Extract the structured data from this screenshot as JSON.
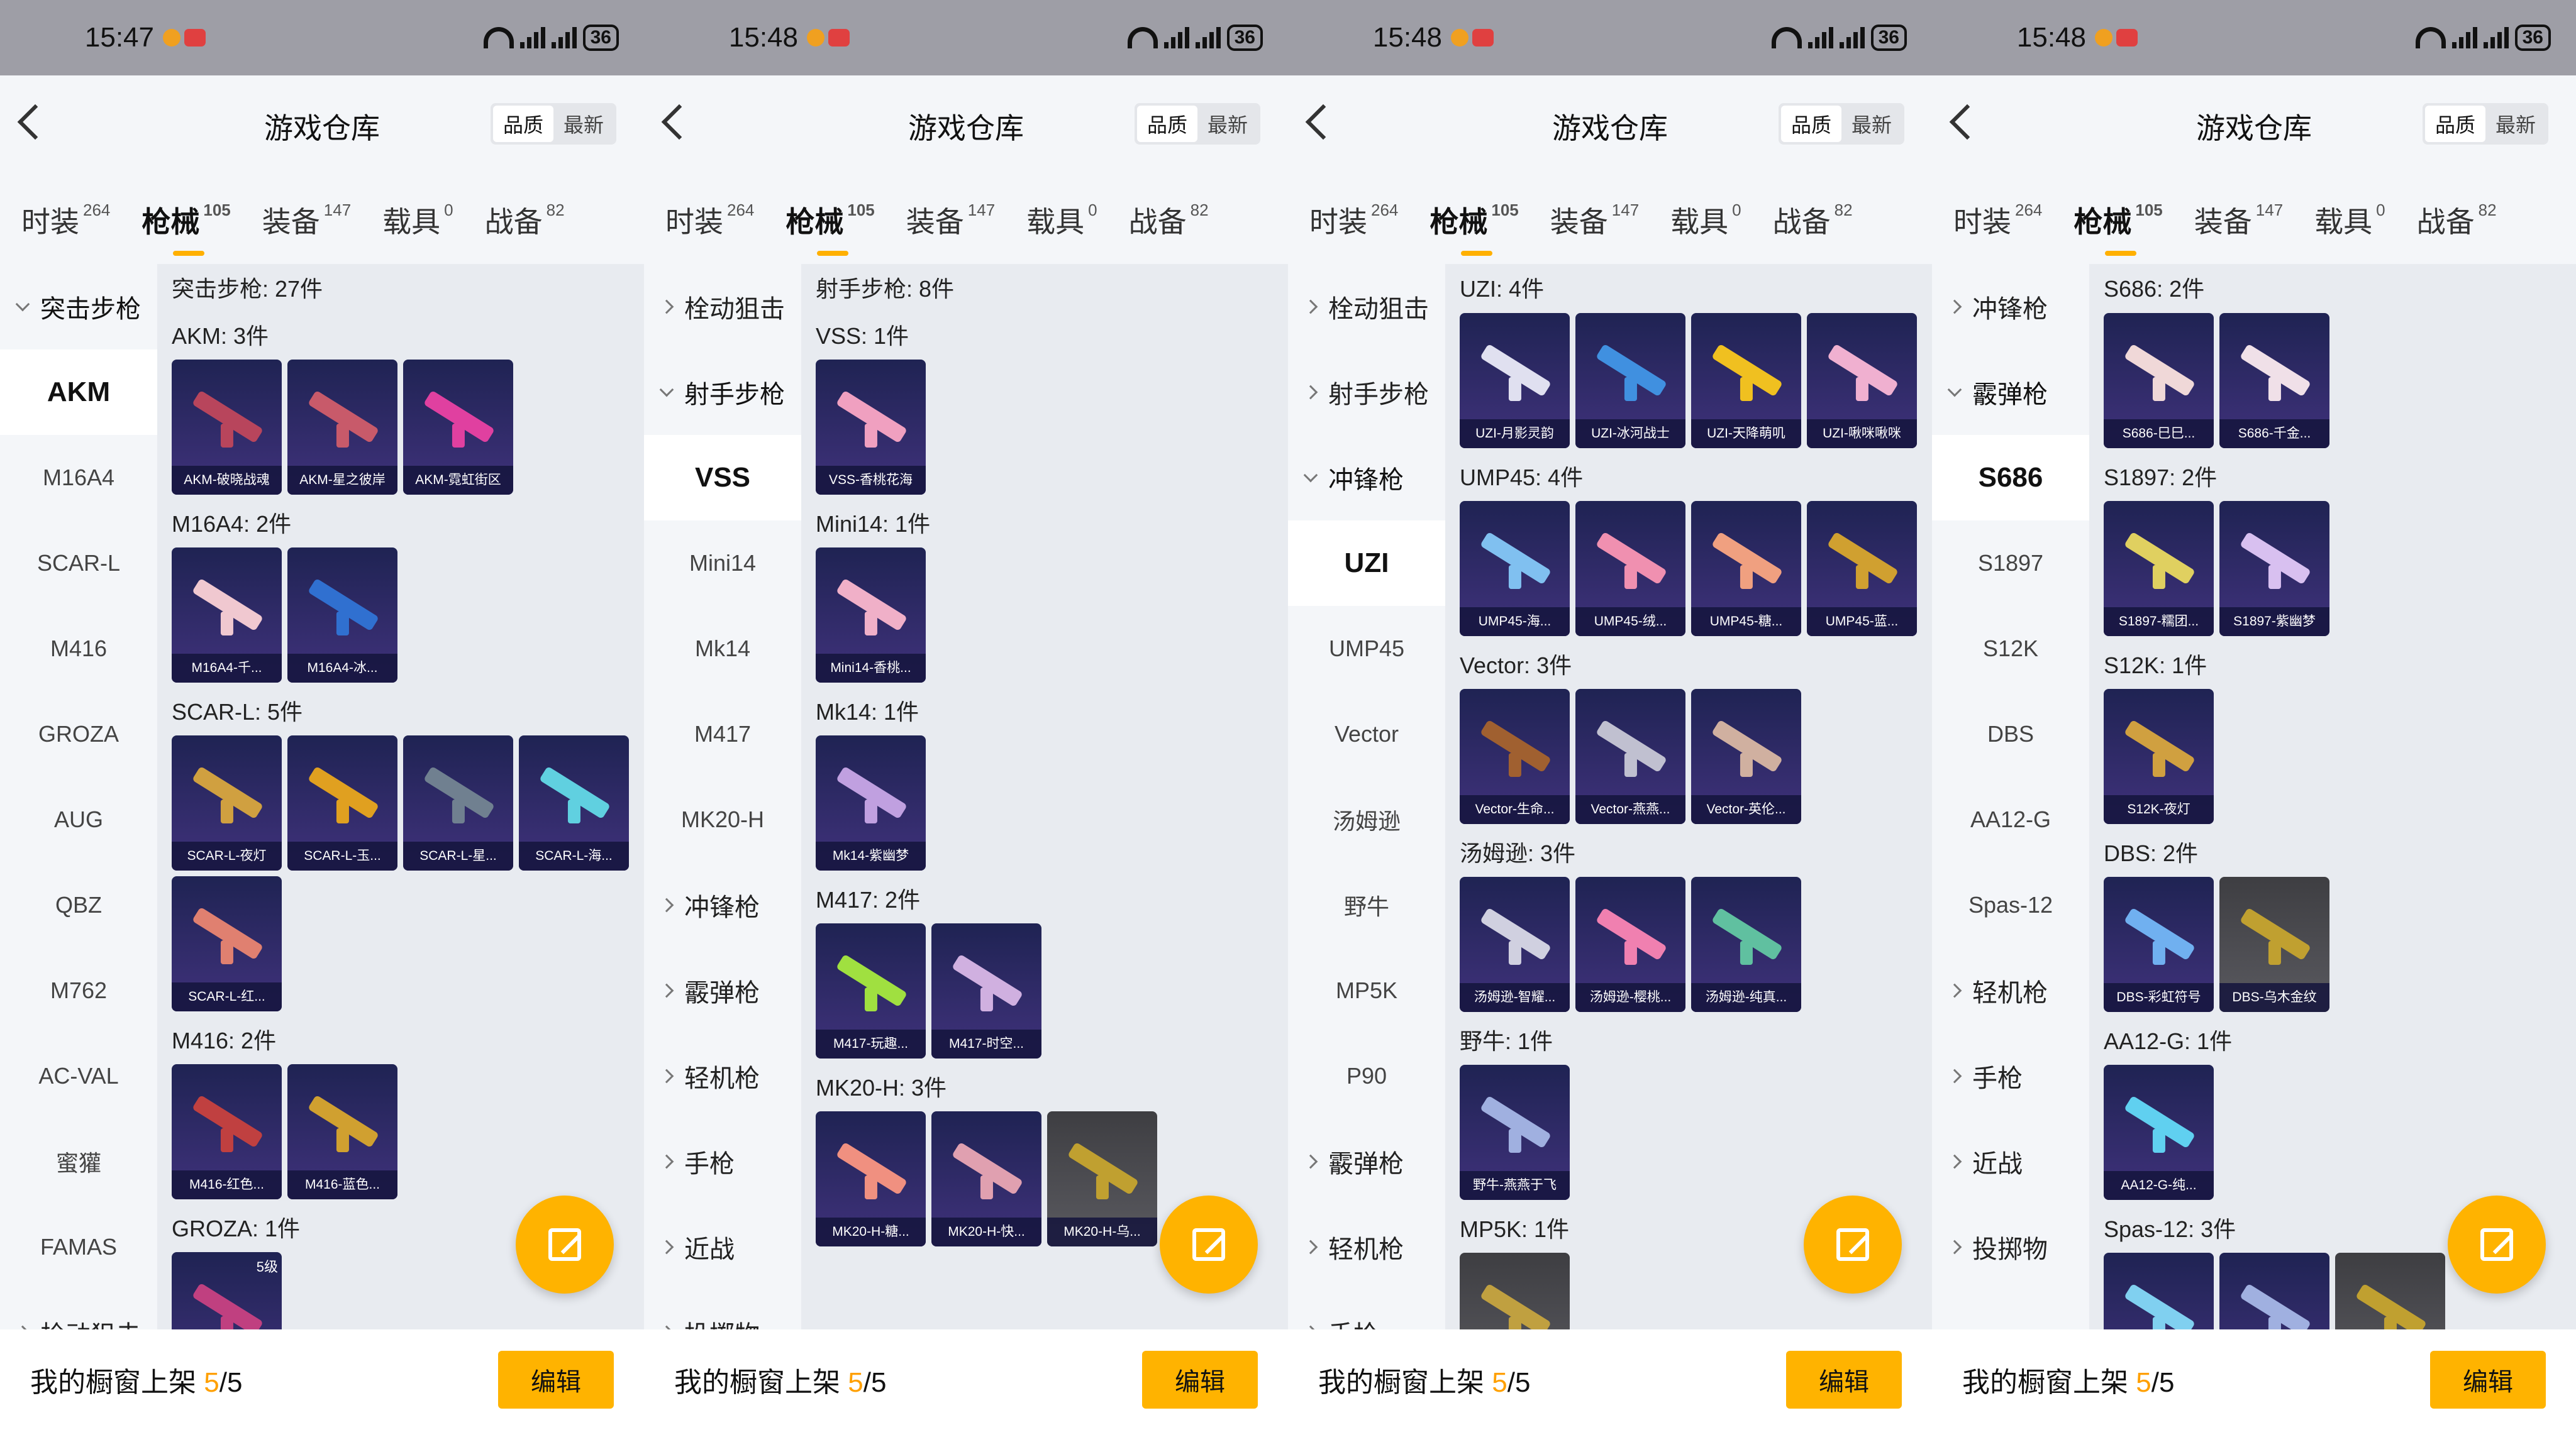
{
  "colors": {
    "accent": "#ffb300",
    "card_bg": "#2a2a66",
    "status_bar": "#9e9ea6"
  },
  "panels": [
    {
      "status": {
        "time": "15:47",
        "battery": "36"
      },
      "title": "游戏仓库",
      "sort": [
        "品质",
        "最新"
      ],
      "tabs": [
        {
          "label": "时装",
          "count": "264"
        },
        {
          "label": "枪械",
          "count": "105",
          "active": true
        },
        {
          "label": "装备",
          "count": "147"
        },
        {
          "label": "载具",
          "count": "0"
        },
        {
          "label": "战备",
          "count": "82"
        }
      ],
      "sidebar": [
        {
          "label": "突击步枪",
          "type": "group",
          "open": true
        },
        {
          "label": "AKM",
          "active": true
        },
        {
          "label": "M16A4"
        },
        {
          "label": "SCAR-L"
        },
        {
          "label": "M416"
        },
        {
          "label": "GROZA"
        },
        {
          "label": "AUG"
        },
        {
          "label": "QBZ"
        },
        {
          "label": "M762"
        },
        {
          "label": "AC-VAL"
        },
        {
          "label": "蜜獾"
        },
        {
          "label": "FAMAS"
        },
        {
          "label": "栓动狙击",
          "type": "group"
        }
      ],
      "sections": [
        {
          "title": "突击步枪: 27件",
          "items": []
        },
        {
          "title": "AKM: 3件",
          "items": [
            {
              "label": "AKM-破晓战魂",
              "gun": "#b8455c"
            },
            {
              "label": "AKM-星之彼岸",
              "gun": "#c85a6a"
            },
            {
              "label": "AKM-霓虹街区",
              "gun": "#e040a0"
            }
          ]
        },
        {
          "title": "M16A4: 2件",
          "items": [
            {
              "label": "M16A4-千...",
              "gun": "#f0c8d0"
            },
            {
              "label": "M16A4-冰...",
              "gun": "#3070d0"
            }
          ]
        },
        {
          "title": "SCAR-L: 5件",
          "items": [
            {
              "label": "SCAR-L-夜灯",
              "gun": "#d0a040"
            },
            {
              "label": "SCAR-L-玉...",
              "gun": "#e0a020"
            },
            {
              "label": "SCAR-L-星...",
              "gun": "#708090"
            },
            {
              "label": "SCAR-L-海...",
              "gun": "#60d0e0"
            },
            {
              "label": "SCAR-L-红...",
              "gun": "#e08070"
            }
          ]
        },
        {
          "title": "M416: 2件",
          "items": [
            {
              "label": "M416-红色...",
              "gun": "#c04040"
            },
            {
              "label": "M416-蓝色...",
              "gun": "#d0a030"
            }
          ]
        },
        {
          "title": "GROZA: 1件",
          "items": [
            {
              "label": "",
              "gun": "#c04080",
              "badge": "5级"
            }
          ]
        }
      ],
      "footer": {
        "text": "我的橱窗上架",
        "count": "5",
        "total": "/5",
        "edit": "编辑"
      }
    },
    {
      "status": {
        "time": "15:48",
        "battery": "36"
      },
      "title": "游戏仓库",
      "sort": [
        "品质",
        "最新"
      ],
      "tabs": [
        {
          "label": "时装",
          "count": "264"
        },
        {
          "label": "枪械",
          "count": "105",
          "active": true
        },
        {
          "label": "装备",
          "count": "147"
        },
        {
          "label": "载具",
          "count": "0"
        },
        {
          "label": "战备",
          "count": "82"
        }
      ],
      "sidebar": [
        {
          "label": "栓动狙击",
          "type": "group"
        },
        {
          "label": "射手步枪",
          "type": "group",
          "open": true
        },
        {
          "label": "VSS",
          "active": true
        },
        {
          "label": "Mini14"
        },
        {
          "label": "Mk14"
        },
        {
          "label": "M417"
        },
        {
          "label": "MK20-H"
        },
        {
          "label": "冲锋枪",
          "type": "group"
        },
        {
          "label": "霰弹枪",
          "type": "group"
        },
        {
          "label": "轻机枪",
          "type": "group"
        },
        {
          "label": "手枪",
          "type": "group"
        },
        {
          "label": "近战",
          "type": "group"
        },
        {
          "label": "投掷物",
          "type": "group"
        }
      ],
      "sections": [
        {
          "title": "射手步枪: 8件",
          "items": []
        },
        {
          "title": "VSS: 1件",
          "items": [
            {
              "label": "VSS-香桃花海",
              "gun": "#f0a0c0"
            }
          ]
        },
        {
          "title": "Mini14: 1件",
          "items": [
            {
              "label": "Mini14-香桃...",
              "gun": "#f0b0c8"
            }
          ]
        },
        {
          "title": "Mk14: 1件",
          "items": [
            {
              "label": "Mk14-紫幽梦",
              "gun": "#c0a0e0"
            }
          ]
        },
        {
          "title": "M417: 2件",
          "items": [
            {
              "label": "M417-玩趣...",
              "gun": "#a0e040"
            },
            {
              "label": "M417-时空...",
              "gun": "#d0b0e0"
            }
          ]
        },
        {
          "title": "MK20-H: 3件",
          "items": [
            {
              "label": "MK20-H-糖...",
              "gun": "#f09080"
            },
            {
              "label": "MK20-H-快...",
              "gun": "#e0a0b0"
            },
            {
              "label": "MK20-H-乌...",
              "gun": "#c0a030",
              "gray": true
            }
          ]
        }
      ],
      "footer": {
        "text": "我的橱窗上架",
        "count": "5",
        "total": "/5",
        "edit": "编辑"
      }
    },
    {
      "status": {
        "time": "15:48",
        "battery": "36"
      },
      "title": "游戏仓库",
      "sort": [
        "品质",
        "最新"
      ],
      "tabs": [
        {
          "label": "时装",
          "count": "264"
        },
        {
          "label": "枪械",
          "count": "105",
          "active": true
        },
        {
          "label": "装备",
          "count": "147"
        },
        {
          "label": "载具",
          "count": "0"
        },
        {
          "label": "战备",
          "count": "82"
        }
      ],
      "sidebar": [
        {
          "label": "栓动狙击",
          "type": "group"
        },
        {
          "label": "射手步枪",
          "type": "group"
        },
        {
          "label": "冲锋枪",
          "type": "group",
          "open": true
        },
        {
          "label": "UZI",
          "active": true
        },
        {
          "label": "UMP45"
        },
        {
          "label": "Vector"
        },
        {
          "label": "汤姆逊"
        },
        {
          "label": "野牛"
        },
        {
          "label": "MP5K"
        },
        {
          "label": "P90"
        },
        {
          "label": "霰弹枪",
          "type": "group"
        },
        {
          "label": "轻机枪",
          "type": "group"
        },
        {
          "label": "手枪",
          "type": "group"
        }
      ],
      "sections": [
        {
          "title": "UZI: 4件",
          "items": [
            {
              "label": "UZI-月影灵韵",
              "gun": "#e0e0f0"
            },
            {
              "label": "UZI-冰河战士",
              "gun": "#4090e0"
            },
            {
              "label": "UZI-天降萌叽",
              "gun": "#f0c020"
            },
            {
              "label": "UZI-啾咪啾咪",
              "gun": "#f0b0d0"
            }
          ]
        },
        {
          "title": "UMP45: 4件",
          "items": [
            {
              "label": "UMP45-海...",
              "gun": "#80c0f0"
            },
            {
              "label": "UMP45-绒...",
              "gun": "#f090b0"
            },
            {
              "label": "UMP45-糖...",
              "gun": "#f0a080"
            },
            {
              "label": "UMP45-蓝...",
              "gun": "#d0a030"
            }
          ]
        },
        {
          "title": "Vector: 3件",
          "items": [
            {
              "label": "Vector-生命...",
              "gun": "#a06030"
            },
            {
              "label": "Vector-燕燕...",
              "gun": "#c0c0d0"
            },
            {
              "label": "Vector-英伦...",
              "gun": "#d0b0a0"
            }
          ]
        },
        {
          "title": "汤姆逊: 3件",
          "items": [
            {
              "label": "汤姆逊-智耀...",
              "gun": "#d0d0e0"
            },
            {
              "label": "汤姆逊-樱桃...",
              "gun": "#f080b0"
            },
            {
              "label": "汤姆逊-纯真...",
              "gun": "#60c0a0"
            }
          ]
        },
        {
          "title": "野牛: 1件",
          "items": [
            {
              "label": "野牛-燕燕于飞",
              "gun": "#a0b0e0"
            }
          ]
        },
        {
          "title": "MP5K: 1件",
          "items": [
            {
              "label": "",
              "gun": "#c0a040",
              "gray": true
            }
          ]
        }
      ],
      "footer": {
        "text": "我的橱窗上架",
        "count": "5",
        "total": "/5",
        "edit": "编辑"
      }
    },
    {
      "status": {
        "time": "15:48",
        "battery": "36"
      },
      "title": "游戏仓库",
      "sort": [
        "品质",
        "最新"
      ],
      "tabs": [
        {
          "label": "时装",
          "count": "264"
        },
        {
          "label": "枪械",
          "count": "105",
          "active": true
        },
        {
          "label": "装备",
          "count": "147"
        },
        {
          "label": "载具",
          "count": "0"
        },
        {
          "label": "战备",
          "count": "82"
        }
      ],
      "sidebar": [
        {
          "label": "冲锋枪",
          "type": "group"
        },
        {
          "label": "霰弹枪",
          "type": "group",
          "open": true
        },
        {
          "label": "S686",
          "active": true
        },
        {
          "label": "S1897"
        },
        {
          "label": "S12K"
        },
        {
          "label": "DBS"
        },
        {
          "label": "AA12-G"
        },
        {
          "label": "Spas-12"
        },
        {
          "label": "轻机枪",
          "type": "group"
        },
        {
          "label": "手枪",
          "type": "group"
        },
        {
          "label": "近战",
          "type": "group"
        },
        {
          "label": "投掷物",
          "type": "group"
        }
      ],
      "sections": [
        {
          "title": "S686: 2件",
          "items": [
            {
              "label": "S686-巳巳...",
              "gun": "#f0d8d8"
            },
            {
              "label": "S686-千金...",
              "gun": "#f0e0e8"
            }
          ]
        },
        {
          "title": "S1897: 2件",
          "items": [
            {
              "label": "S1897-糯团...",
              "gun": "#e0d060"
            },
            {
              "label": "S1897-紫幽梦",
              "gun": "#d8c0f0"
            }
          ]
        },
        {
          "title": "S12K: 1件",
          "items": [
            {
              "label": "S12K-夜灯",
              "gun": "#d0a040"
            }
          ]
        },
        {
          "title": "DBS: 2件",
          "items": [
            {
              "label": "DBS-彩虹符号",
              "gun": "#70b0f0"
            },
            {
              "label": "DBS-乌木金纹",
              "gun": "#c0a030",
              "gray": true
            }
          ]
        },
        {
          "title": "AA12-G: 1件",
          "items": [
            {
              "label": "AA12-G-纯...",
              "gun": "#60d0f0"
            }
          ]
        },
        {
          "title": "Spas-12: 3件",
          "items": [
            {
              "label": "",
              "gun": "#80d0f0"
            },
            {
              "label": "",
              "gun": "#a0b0e0"
            },
            {
              "label": "",
              "gun": "#c0a030",
              "gray": true
            }
          ]
        }
      ],
      "footer": {
        "text": "我的橱窗上架",
        "count": "5",
        "total": "/5",
        "edit": "编辑"
      }
    }
  ]
}
